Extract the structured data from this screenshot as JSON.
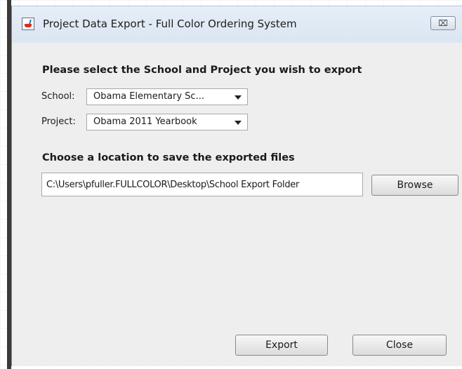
{
  "window": {
    "title": "Project Data Export - Full Color Ordering System",
    "close_glyph": "⌧",
    "icon": "java-cup-icon"
  },
  "selection": {
    "heading": "Please select the School and Project you wish to export",
    "school_label": "School:",
    "school_value": "Obama Elementary Sc...",
    "project_label": "Project:",
    "project_value": "Obama 2011 Yearbook"
  },
  "location": {
    "heading": "Choose a location to save the exported files",
    "path_value": "C:\\Users\\pfuller.FULLCOLOR\\Desktop\\School Export Folder",
    "browse_label": "Browse"
  },
  "actions": {
    "export_label": "Export",
    "close_label": "Close"
  }
}
